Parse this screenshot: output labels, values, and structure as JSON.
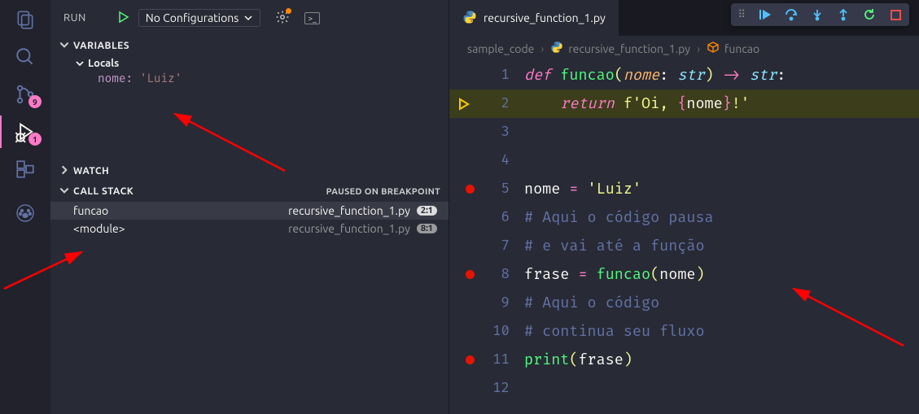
{
  "activity": {
    "scm_badge": "9",
    "debug_badge": "1"
  },
  "run": {
    "label": "RUN",
    "config": "No Configurations"
  },
  "sections": {
    "variables": "VARIABLES",
    "locals": "Locals",
    "watch": "WATCH",
    "callstack": "CALL STACK",
    "status": "PAUSED ON BREAKPOINT"
  },
  "vars": {
    "name": "nome:",
    "value": "'Luiz'"
  },
  "callstack": [
    {
      "func": "funcao",
      "file": "recursive_function_1.py",
      "pos": "2:1"
    },
    {
      "func": "<module>",
      "file": "recursive_function_1.py",
      "pos": "8:1"
    }
  ],
  "tab": {
    "file": "recursive_function_1.py"
  },
  "breadcrumb": {
    "folder": "sample_code",
    "file": "recursive_function_1.py",
    "symbol": "funcao"
  },
  "code": {
    "lines": [
      "1",
      "2",
      "3",
      "4",
      "5",
      "6",
      "7",
      "8",
      "9",
      "10",
      "11",
      "12"
    ],
    "l1": {
      "def": "def ",
      "fn": "funcao",
      "lp": "(",
      "param": "nome",
      "colon1": ": ",
      "type1": "str",
      "rp": ")",
      "arrow": " -> ",
      "type2": "str",
      "colon2": ":"
    },
    "l2": {
      "indent": "    ",
      "ret": "return ",
      "s1": "f'Oi, ",
      "lb": "{",
      "v": "nome",
      "rb": "}",
      "s2": "!'"
    },
    "l5": {
      "v": "nome ",
      "eq": "=",
      "s": " 'Luiz'"
    },
    "l6": "# Aqui o código pausa",
    "l7": "# e vai até a função",
    "l8": {
      "v": "frase ",
      "eq": "=",
      "sp": " ",
      "fn": "funcao",
      "lp": "(",
      "arg": "nome",
      "rp": ")"
    },
    "l9": "# Aqui o código",
    "l10": "# continua seu fluxo",
    "l11": {
      "fn": "print",
      "lp": "(",
      "arg": "frase",
      "rp": ")"
    }
  }
}
